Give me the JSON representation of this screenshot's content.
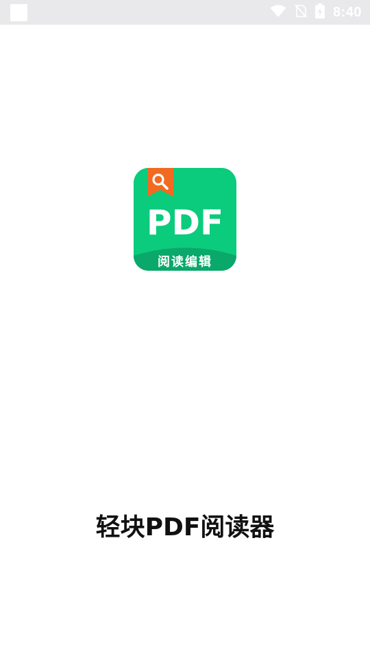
{
  "status_bar": {
    "time": "8:40",
    "icons": [
      "wifi-icon",
      "no-sim-icon",
      "battery-charging-icon"
    ]
  },
  "splash": {
    "logo": {
      "main_text": "PDF",
      "sub_text": "阅读编辑",
      "icon": "search-icon",
      "colors": {
        "background": "#0bcb7c",
        "bottom_band": "#0aa86a",
        "bookmark": "#f26a21"
      }
    },
    "app_name": "轻块PDF阅读器"
  }
}
